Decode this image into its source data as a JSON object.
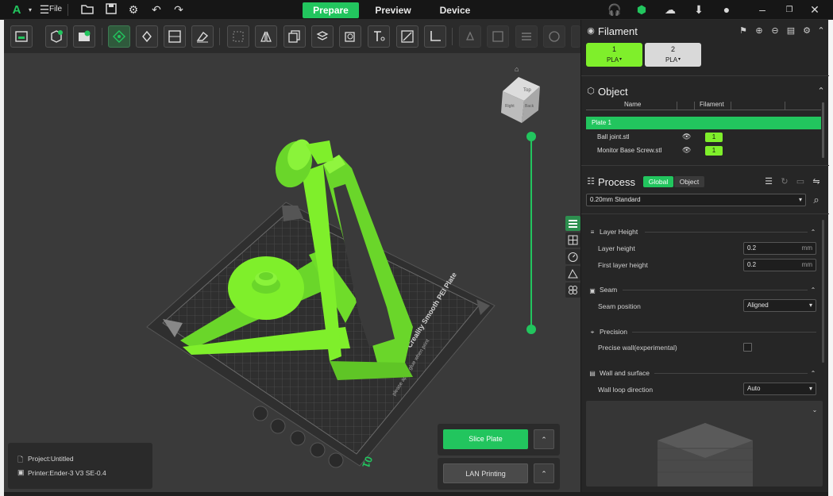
{
  "titlebar": {
    "file_label": "File",
    "tabs": [
      {
        "label": "Prepare",
        "active": true
      },
      {
        "label": "Preview",
        "active": false
      },
      {
        "label": "Device",
        "active": false
      }
    ]
  },
  "accent_color": "#22c55e",
  "model_color": "#7fef2b",
  "filament": {
    "title": "Filament",
    "slots": [
      {
        "number": "1",
        "type": "PLA",
        "color": "#7fef2b"
      },
      {
        "number": "2",
        "type": "PLA",
        "color": "#d9d9d9"
      }
    ]
  },
  "object": {
    "title": "Object",
    "col_name": "Name",
    "col_filament": "Filament",
    "plate_label": "Plate 1",
    "items": [
      {
        "name": "Ball joint.stl",
        "filament": "1"
      },
      {
        "name": "Monitor Base Screw.stl",
        "filament": "1"
      }
    ]
  },
  "process": {
    "title": "Process",
    "tab_global": "Global",
    "tab_object": "Object",
    "preset": "0.20mm Standard",
    "groups": {
      "layer_height": {
        "title": "Layer Height",
        "layer_height_label": "Layer height",
        "layer_height_value": "0.2",
        "first_layer_label": "First layer height",
        "first_layer_value": "0.2",
        "unit": "mm"
      },
      "seam": {
        "title": "Seam",
        "position_label": "Seam position",
        "position_value": "Aligned"
      },
      "precision": {
        "title": "Precision",
        "precise_wall_label": "Precise wall(experimental)"
      },
      "wall": {
        "title": "Wall and surface",
        "loop_label": "Wall loop direction",
        "loop_value": "Auto"
      }
    }
  },
  "bed": {
    "plate_name": "Creality Smooth PEI Plate",
    "plate_note": "please apply glue when print",
    "plate_index": "01"
  },
  "actions": {
    "slice_label": "Slice Plate",
    "lan_label": "LAN Printing"
  },
  "status": {
    "project": "Project:Untitled",
    "printer": "Printer:Ender-3 V3 SE-0.4"
  },
  "navcube": {
    "top": "Top",
    "right": "Right",
    "back": "Back"
  }
}
